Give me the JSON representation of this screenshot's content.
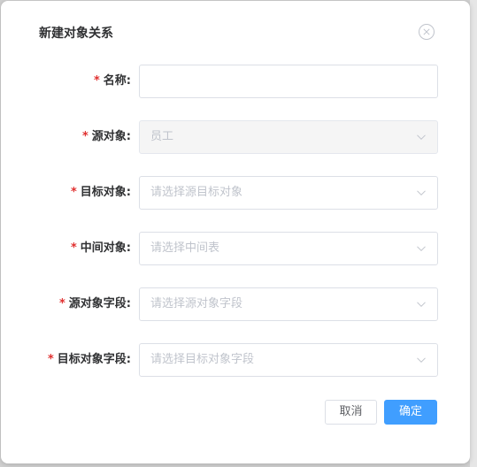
{
  "dialog": {
    "title": "新建对象关系",
    "close_icon": "close-circle-icon"
  },
  "form": {
    "required_mark": "*",
    "fields": [
      {
        "label": "名称:",
        "type": "text",
        "value": "",
        "placeholder": ""
      },
      {
        "label": "源对象:",
        "type": "select",
        "value": "员工",
        "disabled": true
      },
      {
        "label": "目标对象:",
        "type": "select",
        "placeholder": "请选择源目标对象"
      },
      {
        "label": "中间对象:",
        "type": "select",
        "placeholder": "请选择中间表"
      },
      {
        "label": "源对象字段:",
        "type": "select",
        "placeholder": "请选择源对象字段"
      },
      {
        "label": "目标对象字段:",
        "type": "select",
        "placeholder": "请选择目标对象字段"
      }
    ]
  },
  "footer": {
    "cancel_label": "取消",
    "confirm_label": "确定"
  },
  "colors": {
    "primary": "#409eff",
    "required": "#e0302f",
    "placeholder": "#c0c4cc",
    "border": "#dcdfe6"
  }
}
